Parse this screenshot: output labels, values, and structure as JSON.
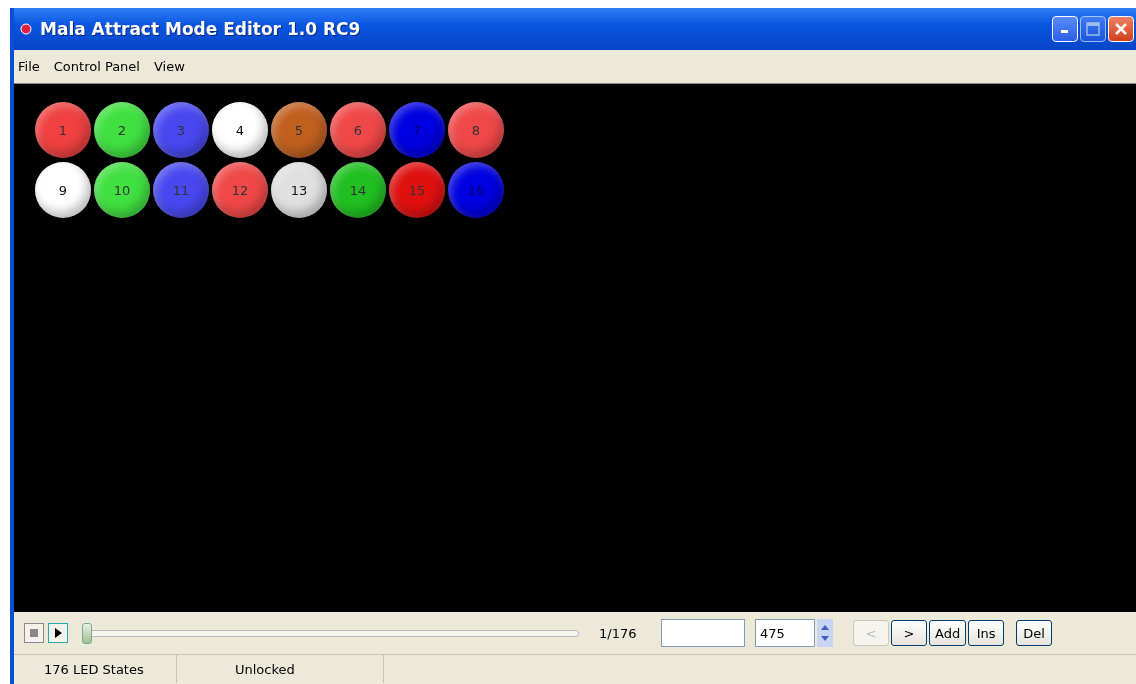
{
  "window": {
    "title": "Mala Attract Mode Editor 1.0 RC9"
  },
  "menu": [
    {
      "label": "File"
    },
    {
      "label": "Control Panel"
    },
    {
      "label": "View"
    }
  ],
  "leds": [
    {
      "label": "1",
      "color": "#f04040"
    },
    {
      "label": "2",
      "color": "#40e040"
    },
    {
      "label": "3",
      "color": "#4848f0"
    },
    {
      "label": "4",
      "color": "#ffffff"
    },
    {
      "label": "5",
      "color": "#c06020"
    },
    {
      "label": "6",
      "color": "#f04848"
    },
    {
      "label": "7",
      "color": "#0000e0"
    },
    {
      "label": "8",
      "color": "#f04848"
    },
    {
      "label": "9",
      "color": "#ffffff"
    },
    {
      "label": "10",
      "color": "#40e040"
    },
    {
      "label": "11",
      "color": "#4848f0"
    },
    {
      "label": "12",
      "color": "#f04848"
    },
    {
      "label": "13",
      "color": "#e0e0e0"
    },
    {
      "label": "14",
      "color": "#20c020"
    },
    {
      "label": "15",
      "color": "#e01010"
    },
    {
      "label": "16",
      "color": "#0000e0"
    }
  ],
  "toolbar": {
    "slider": {
      "level": 0
    },
    "position": "1/176",
    "field_2": {
      "value": "475"
    },
    "buttons": [
      {
        "label": "<",
        "disabled": true
      },
      {
        "label": ">",
        "disabled": false
      },
      {
        "label": "Add",
        "disabled": false
      },
      {
        "label": "Ins",
        "disabled": false
      },
      {
        "label": "Del",
        "disabled": false
      }
    ]
  },
  "status_bar": [
    "176 LED States",
    "Unlocked"
  ]
}
